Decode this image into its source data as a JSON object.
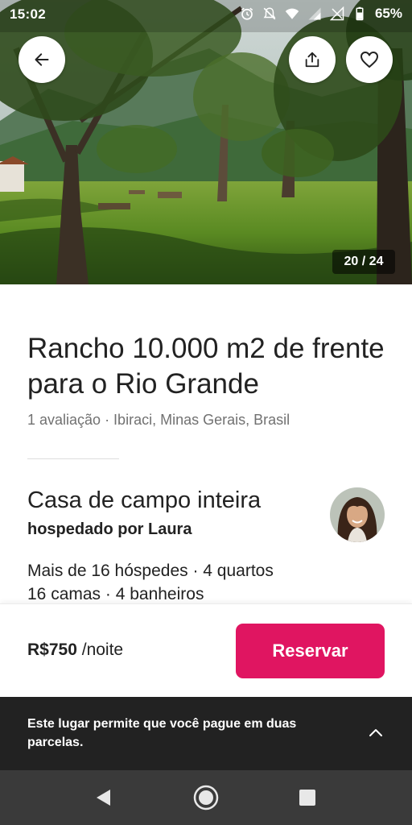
{
  "status_bar": {
    "time": "15:02",
    "battery": "65%",
    "icons": [
      "alarm-icon",
      "mute-icon",
      "wifi-icon",
      "signal-icon",
      "signal-icon",
      "battery-icon"
    ]
  },
  "gallery": {
    "counter": "20 / 24",
    "icons": {
      "back": "arrow-left-icon",
      "share": "share-icon",
      "favorite": "heart-icon"
    }
  },
  "listing": {
    "title": "Rancho 10.000 m2 de frente para o Rio Grande",
    "meta": "1 avaliação · Ibiraci, Minas Gerais, Brasil",
    "property_type": "Casa de campo inteira",
    "host_line": "hospedado por Laura",
    "capacity_line_1": "Mais de 16 hóspedes · 4 quartos",
    "capacity_line_2": "16 camas · 4 banheiros"
  },
  "booking": {
    "price": "R$750",
    "unit": "/noite",
    "reserve_label": "Reservar"
  },
  "notice": {
    "text": "Este lugar permite que você pague em duas parcelas."
  },
  "colors": {
    "accent": "#e01561",
    "text": "#222222",
    "muted": "#717171",
    "banner": "#222222",
    "nav_bar": "#3a3a3a"
  }
}
